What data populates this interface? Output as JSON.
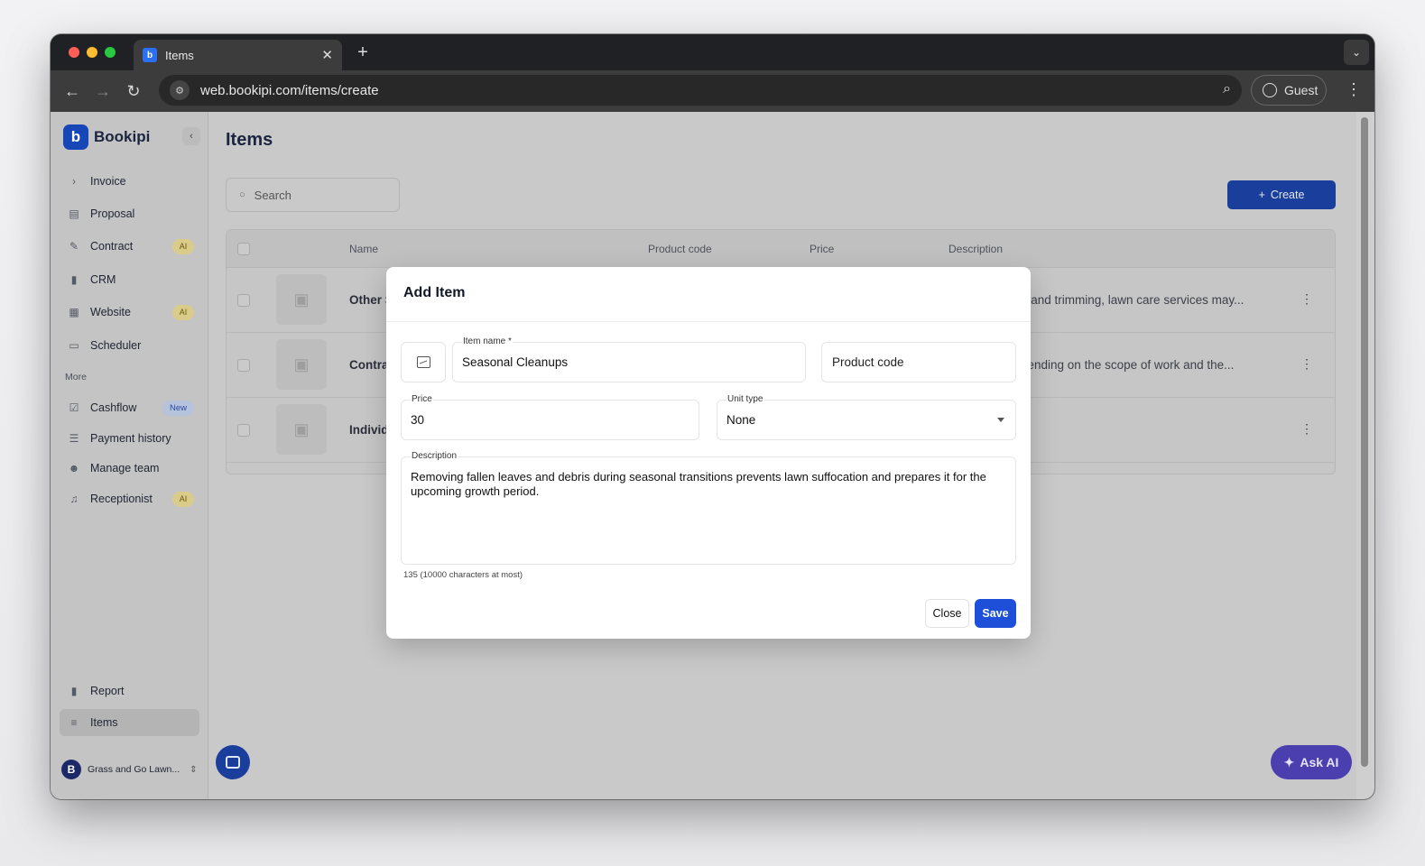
{
  "browser": {
    "tab_title": "Items",
    "url": "web.bookipi.com/items/create",
    "profile_label": "Guest"
  },
  "sidebar": {
    "brand": "Bookipi",
    "items": [
      {
        "label": "Invoice"
      },
      {
        "label": "Proposal"
      },
      {
        "label": "Contract",
        "badge": "AI"
      },
      {
        "label": "CRM"
      },
      {
        "label": "Website",
        "badge": "AI"
      },
      {
        "label": "Scheduler"
      }
    ],
    "more_label": "More",
    "more_items": [
      {
        "label": "Cashflow",
        "badge": "New"
      },
      {
        "label": "Payment history"
      },
      {
        "label": "Manage team"
      },
      {
        "label": "Receptionist",
        "badge": "AI"
      }
    ],
    "bottom_items": [
      {
        "label": "Report"
      },
      {
        "label": "Items"
      }
    ],
    "workspace": "Grass and Go Lawn..."
  },
  "main": {
    "title": "Items",
    "search_placeholder": "Search",
    "create_label": "Create",
    "table": {
      "headers": [
        "Name",
        "Product code",
        "Price",
        "Description"
      ],
      "rows": [
        {
          "name": "Other S",
          "description": "g and trimming, lawn care services may..."
        },
        {
          "name": "Contra",
          "description": "pending on the scope of work and the..."
        },
        {
          "name": "Individ",
          "description": ""
        }
      ]
    },
    "ask_ai_label": "Ask AI"
  },
  "modal": {
    "title": "Add Item",
    "item_name_label": "Item name *",
    "item_name_value": "Seasonal Cleanups",
    "product_code_placeholder": "Product code",
    "price_label": "Price",
    "price_value": "30",
    "unit_type_label": "Unit type",
    "unit_type_value": "None",
    "description_label": "Description",
    "description_value": "Removing fallen leaves and debris during seasonal transitions prevents lawn suffocation and prepares it for the upcoming growth period.",
    "char_count": "135 (10000 characters at most)",
    "close_label": "Close",
    "save_label": "Save"
  }
}
